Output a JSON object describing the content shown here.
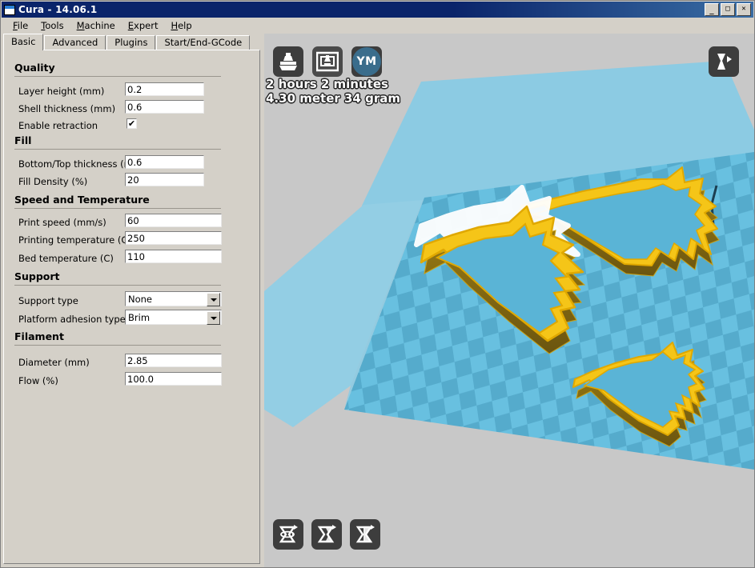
{
  "window": {
    "title": "Cura - 14.06.1",
    "icon": "app-window-icon",
    "buttons": {
      "minimize": "_",
      "maximize": "□",
      "close": "✕"
    }
  },
  "menubar": {
    "items": [
      {
        "label": "File",
        "accel": "F"
      },
      {
        "label": "Tools",
        "accel": "T"
      },
      {
        "label": "Machine",
        "accel": "M"
      },
      {
        "label": "Expert",
        "accel": "E"
      },
      {
        "label": "Help",
        "accel": "H"
      }
    ]
  },
  "tabs": [
    {
      "label": "Basic",
      "active": true
    },
    {
      "label": "Advanced",
      "active": false
    },
    {
      "label": "Plugins",
      "active": false
    },
    {
      "label": "Start/End-GCode",
      "active": false
    }
  ],
  "settings": {
    "sections": [
      {
        "title": "Quality",
        "rows": [
          {
            "label": "Layer height (mm)",
            "type": "text",
            "value": "0.2"
          },
          {
            "label": "Shell thickness (mm)",
            "type": "text",
            "value": "0.6"
          },
          {
            "label": "Enable retraction",
            "type": "checkbox",
            "value": "✔",
            "checked": true
          }
        ]
      },
      {
        "title": "Fill",
        "rows": [
          {
            "label": "Bottom/Top thickness (mm)",
            "type": "text",
            "value": "0.6"
          },
          {
            "label": "Fill Density (%)",
            "type": "text",
            "value": "20"
          }
        ]
      },
      {
        "title": "Speed and Temperature",
        "rows": [
          {
            "label": "Print speed (mm/s)",
            "type": "text",
            "value": "60"
          },
          {
            "label": "Printing temperature (C)",
            "type": "text",
            "value": "250"
          },
          {
            "label": "Bed temperature (C)",
            "type": "text",
            "value": "110"
          }
        ]
      },
      {
        "title": "Support",
        "rows": [
          {
            "label": "Support type",
            "type": "select",
            "value": "None"
          },
          {
            "label": "Platform adhesion type",
            "type": "select",
            "value": "Brim"
          }
        ]
      },
      {
        "title": "Filament",
        "rows": [
          {
            "label": "Diameter (mm)",
            "type": "text",
            "value": "2.85"
          },
          {
            "label": "Flow (%)",
            "type": "text",
            "value": "100.0"
          }
        ]
      }
    ]
  },
  "viewport": {
    "toolbar_top": [
      {
        "name": "load-model-button",
        "icon": "load-model-icon"
      },
      {
        "name": "save-toolpath-button",
        "icon": "save-gcode-icon"
      },
      {
        "name": "youmagine-button",
        "icon": "youmagine-icon",
        "label": "YM"
      }
    ],
    "toolbar_bottom": [
      {
        "name": "rotate-button",
        "icon": "rotate-model-icon"
      },
      {
        "name": "scale-button",
        "icon": "scale-model-icon"
      },
      {
        "name": "mirror-button",
        "icon": "mirror-model-icon"
      }
    ],
    "view-mode-button": {
      "name": "view-mode-button",
      "icon": "layer-view-icon"
    },
    "print_time": "2 hours 2 minutes",
    "material_usage": "4.30 meter 34 gram"
  },
  "colors": {
    "title_bar": "#0a246a",
    "panel_face": "#d4d0c8",
    "viewport_bg": "#c8c8c8",
    "build_volume": "#8ccbe3",
    "plate_light": "#68c0e0",
    "plate_dark": "#54a9cb",
    "model_top": "#f5c518",
    "model_side": "#7a6312",
    "youmagine_blue": "#3a6d8c"
  }
}
